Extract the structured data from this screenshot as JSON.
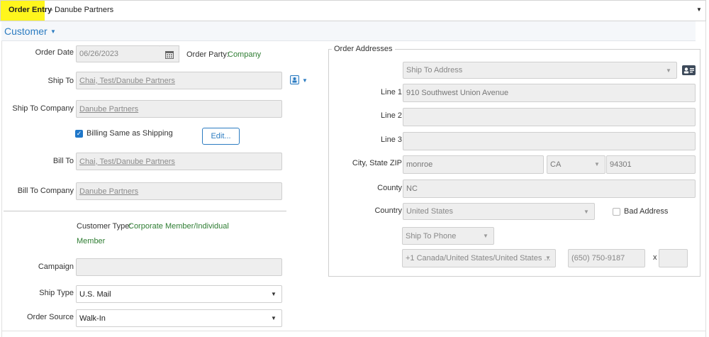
{
  "topbar": {
    "title": "Order Entry",
    "separator": "-",
    "company": "Danube Partners"
  },
  "section": {
    "title": "Customer"
  },
  "order": {
    "date_label": "Order Date",
    "date_value": "06/26/2023",
    "party_label": "Order Party:",
    "party_value": "Company",
    "ship_to_label": "Ship To",
    "ship_to_value": "Chai, Test/Danube Partners",
    "ship_to_company_label": "Ship To Company",
    "ship_to_company_value": "Danube Partners",
    "billing_same_label": "Billing Same as Shipping",
    "billing_same_checked": true,
    "edit_label": "Edit...",
    "bill_to_label": "Bill To",
    "bill_to_value": "Chai, Test/Danube Partners",
    "bill_to_company_label": "Bill To Company",
    "bill_to_company_value": "Danube Partners",
    "customer_type_label": "Customer Type:",
    "customer_type_line1": "Corporate Member/Individual",
    "customer_type_line2": "Member",
    "campaign_label": "Campaign",
    "campaign_value": "",
    "ship_type_label": "Ship Type",
    "ship_type_value": "U.S. Mail",
    "order_source_label": "Order Source",
    "order_source_value": "Walk-In"
  },
  "addresses": {
    "legend": "Order Addresses",
    "address_select": "Ship To Address",
    "line1_label": "Line 1",
    "line1_value": "910 Southwest Union Avenue",
    "line2_label": "Line 2",
    "line2_value": "",
    "line3_label": "Line 3",
    "line3_value": "",
    "city_state_zip_label": "City, State ZIP",
    "city_value": "monroe",
    "state_value": "CA",
    "zip_value": "94301",
    "county_label": "County",
    "county_value": "NC",
    "country_label": "Country",
    "country_value": "United States",
    "bad_address_label": "Bad Address",
    "phone_type": "Ship To Phone",
    "phone_country": "+1 Canada/United States/United States ...",
    "phone_number": "(650) 750-9187",
    "ext_label": "x",
    "ext_value": ""
  },
  "icons": {
    "calendar": "calendar-icon",
    "contact": "contact-card-icon",
    "person": "person-icon"
  },
  "colors": {
    "highlight": "#fff61d",
    "accent": "#2c7cc1",
    "value_green": "#2e7d32"
  }
}
